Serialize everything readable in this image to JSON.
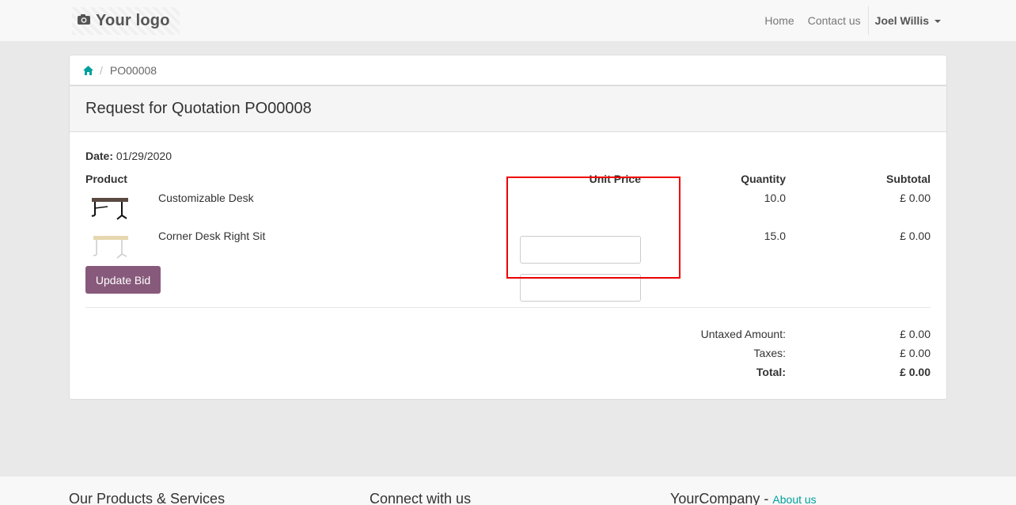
{
  "header": {
    "logo_text": "Your logo",
    "nav": [
      "Home",
      "Contact us"
    ],
    "user_name": "Joel Willis"
  },
  "breadcrumb": {
    "current": "PO00008"
  },
  "document": {
    "title": "Request for Quotation PO00008",
    "date_label": "Date:",
    "date_value": "01/29/2020",
    "columns": {
      "product": "Product",
      "unit_price": "Unit Price",
      "quantity": "Quantity",
      "subtotal": "Subtotal"
    },
    "lines": [
      {
        "product": "Customizable Desk",
        "unit_price": "",
        "quantity": "10.0",
        "subtotal": "£ 0.00",
        "image": "black-desk-thumbnail"
      },
      {
        "product": "Corner Desk Right Sit",
        "unit_price": "",
        "quantity": "15.0",
        "subtotal": "£ 0.00",
        "image": "beige-desk-thumbnail"
      }
    ],
    "update_button": "Update Bid",
    "totals": {
      "untaxed_label": "Untaxed Amount:",
      "untaxed_value": "£ 0.00",
      "taxes_label": "Taxes:",
      "taxes_value": "£ 0.00",
      "total_label": "Total:",
      "total_value": "£ 0.00"
    }
  },
  "footer": {
    "col1": "Our Products & Services",
    "col2": "Connect with us",
    "col3_company": "YourCompany",
    "col3_sep": " - ",
    "col3_link": "About us"
  },
  "colors": {
    "brand": "#875A7B",
    "link": "#00A09D",
    "highlight": "#e00000"
  }
}
